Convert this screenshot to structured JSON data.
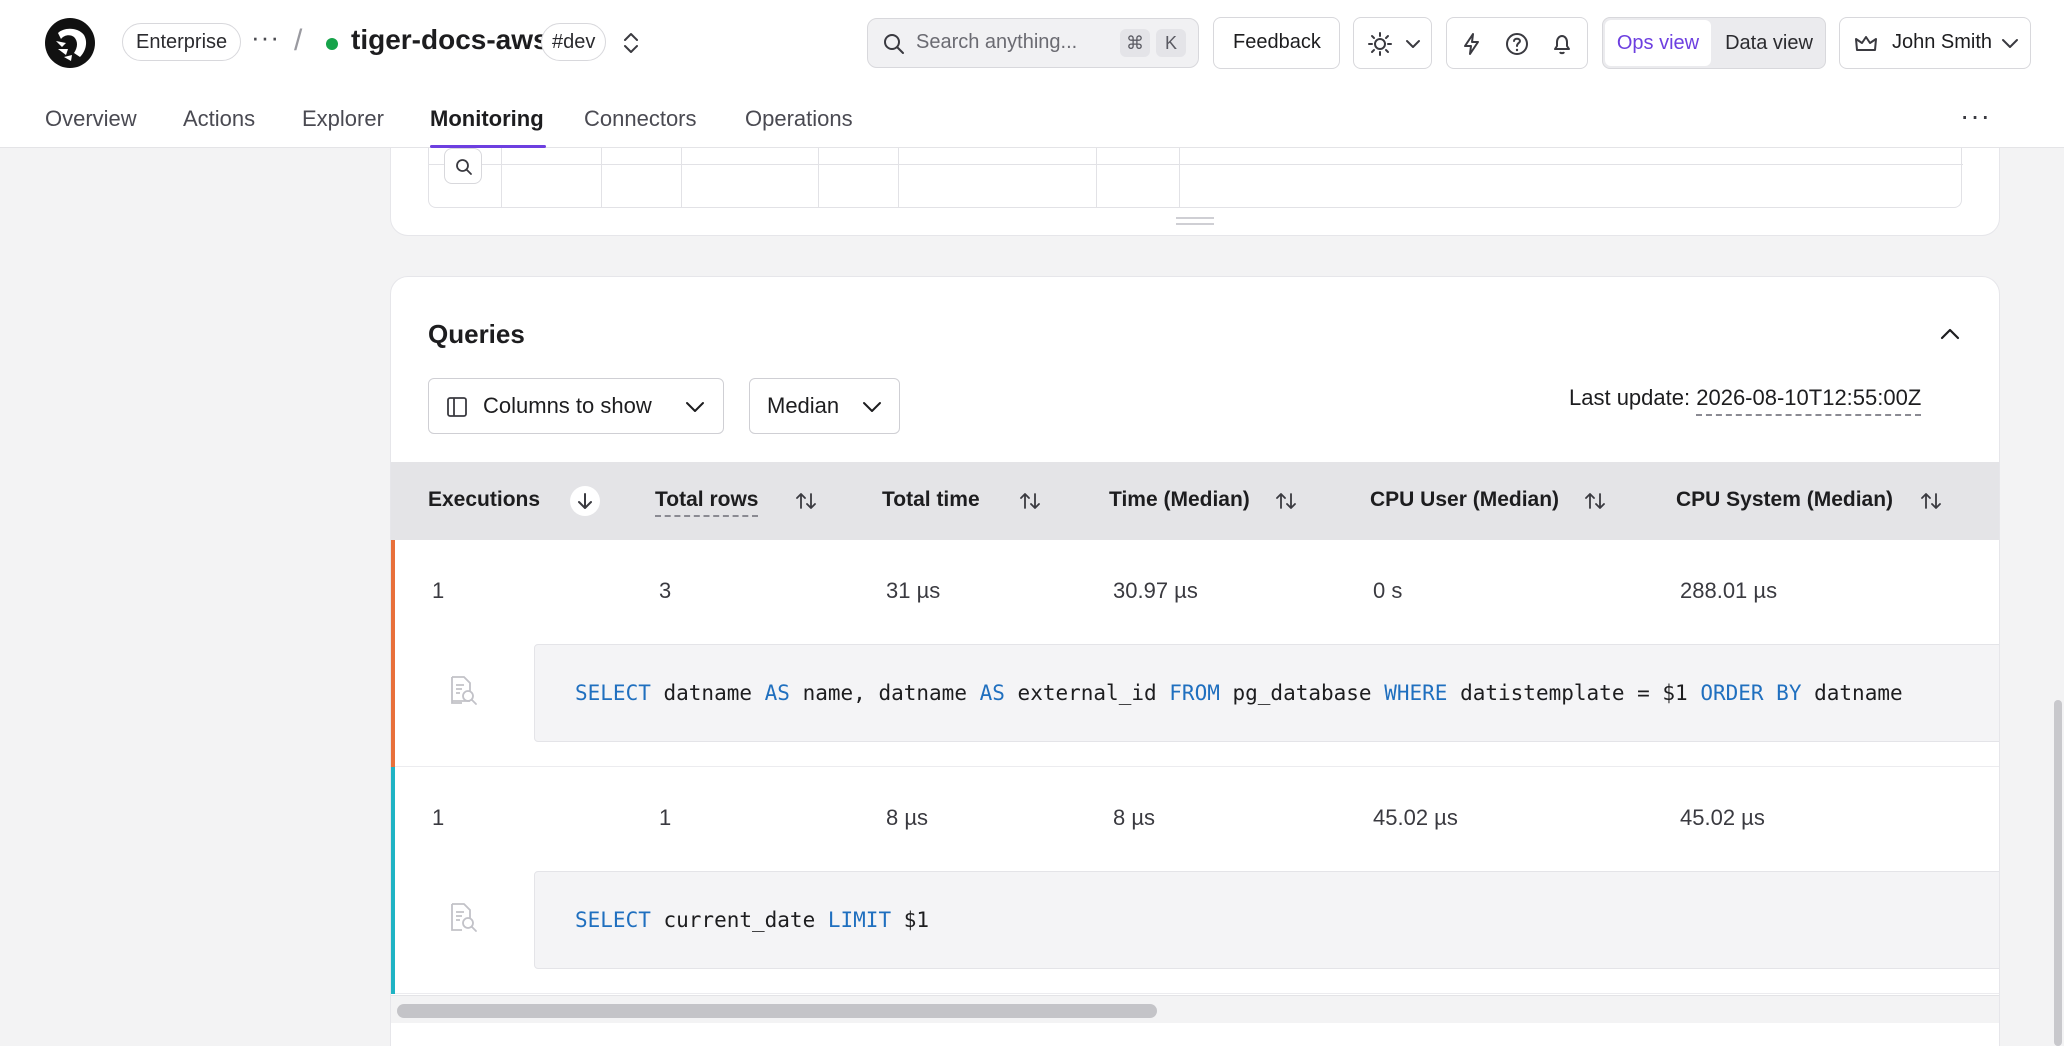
{
  "header": {
    "plan_badge": "Enterprise",
    "more_glyph": "···",
    "separator": "/",
    "project_name": "tiger-docs-aws",
    "env_tag": "#dev",
    "search_placeholder": "Search anything...",
    "shortcut_cmd": "⌘",
    "shortcut_key": "K",
    "feedback_label": "Feedback",
    "view_toggle": {
      "ops": "Ops view",
      "data": "Data view"
    },
    "user_name": "John Smith",
    "status_color": "#16a34a",
    "accent_color": "#6d3fe0"
  },
  "tabs": [
    {
      "label": "Overview"
    },
    {
      "label": "Actions"
    },
    {
      "label": "Explorer"
    },
    {
      "label": "Monitoring",
      "active": true
    },
    {
      "label": "Connectors"
    },
    {
      "label": "Operations"
    }
  ],
  "more_menu_glyph": "···",
  "queries": {
    "title": "Queries",
    "columns_button": "Columns to show",
    "aggregate_select": "Median",
    "last_update_label": "Last update:",
    "last_update_value": "2026-08-10T12:55:00Z",
    "columns": [
      {
        "label": "Executions",
        "sort": "desc"
      },
      {
        "label": "Total rows",
        "sort": "none"
      },
      {
        "label": "Total time",
        "sort": "none"
      },
      {
        "label": "Time (Median)",
        "sort": "none"
      },
      {
        "label": "CPU User (Median)",
        "sort": "none"
      },
      {
        "label": "CPU System (Median)",
        "sort": "none"
      }
    ],
    "rows": [
      {
        "executions": "1",
        "total_rows": "3",
        "total_time": "31 µs",
        "time_median": "30.97 µs",
        "cpu_user": "0 s",
        "cpu_system": "288.01 µs",
        "color": "#e8703a",
        "sql_tokens": [
          {
            "t": "SELECT",
            "kw": true
          },
          {
            "t": " datname "
          },
          {
            "t": "AS",
            "kw": true
          },
          {
            "t": " name, datname "
          },
          {
            "t": "AS",
            "kw": true
          },
          {
            "t": " external_id "
          },
          {
            "t": "FROM",
            "kw": true
          },
          {
            "t": " pg_database "
          },
          {
            "t": "WHERE",
            "kw": true
          },
          {
            "t": " datistemplate = $1 "
          },
          {
            "t": "ORDER BY",
            "kw": true
          },
          {
            "t": " datname"
          }
        ]
      },
      {
        "executions": "1",
        "total_rows": "1",
        "total_time": "8 µs",
        "time_median": "8 µs",
        "cpu_user": "45.02 µs",
        "cpu_system": "45.02 µs",
        "color": "#1fb3c4",
        "sql_tokens": [
          {
            "t": "SELECT",
            "kw": true
          },
          {
            "t": " current_date "
          },
          {
            "t": "LIMIT",
            "kw": true
          },
          {
            "t": " $1"
          }
        ]
      }
    ]
  }
}
